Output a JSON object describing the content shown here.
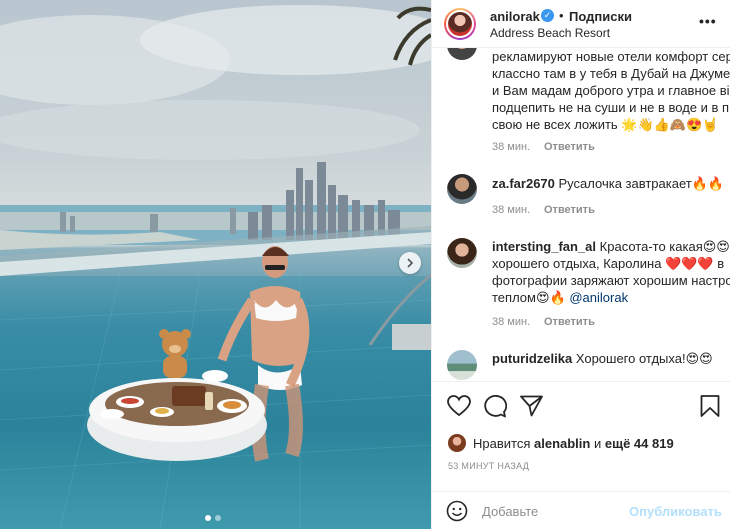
{
  "post": {
    "user": "anilorak",
    "follow_label": "Подписки",
    "location": "Address Beach Resort",
    "more": "•••",
    "verified_mark": "✓"
  },
  "comments": [
    {
      "user": "",
      "lines": [
        "рекламируют новые отели комфорт сер",
        "классно там в у тебя в Дубай на Джуме",
        "и Вам мадам доброго утра и главное ві",
        "подцепить не на суши и не в воде и в п",
        "свою не всех ложить 🌟👋👍🙈😍🤘"
      ],
      "time": "38 мин.",
      "reply": "Ответить"
    },
    {
      "user": "za.far2670",
      "text": "Русалочка завтракает🔥🔥",
      "time": "38 мин.",
      "reply": "Ответить"
    },
    {
      "user": "intersting_fan_al",
      "text": "Красота-то какая😍😍",
      "lines": [
        "хорошего отдыха, Каролина ❤️❤️❤️ в",
        "фотографии заряжают хорошим настро"
      ],
      "last_line": "теплом😍🔥",
      "mention": "@anilorak",
      "time": "38 мин.",
      "reply": "Ответить"
    },
    {
      "user": "puturidzelika",
      "text": "Хорошего отдыха!😍😍"
    }
  ],
  "likes": {
    "prefix": "Нравится",
    "user": "alenablin",
    "middle": "и",
    "count": "ещё 44 819"
  },
  "time_ago": "53 МИНУТ НАЗАД",
  "composer": {
    "placeholder": "Добавьте",
    "publish": "Опубликовать"
  },
  "colors": {
    "accent": "#3897f0",
    "publish_disabled": "#b2dffc",
    "meta_text": "#8e8e8e",
    "mention": "#00376b"
  },
  "icons": [
    "chevron-right-icon",
    "heart-icon",
    "comment-icon",
    "share-icon",
    "bookmark-icon",
    "smile-icon",
    "verified-icon",
    "more-icon"
  ],
  "carousel": {
    "slides": 2,
    "active": 1
  }
}
